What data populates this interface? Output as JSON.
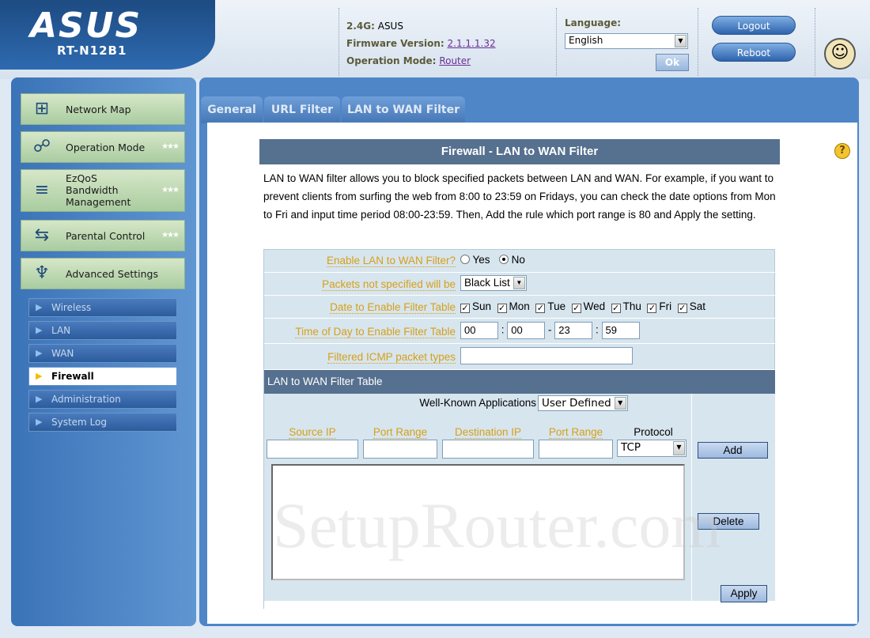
{
  "brand": {
    "logo": "ASUS",
    "model": "RT-N12B1"
  },
  "status": {
    "band_label": "2.4G:",
    "band_value": "ASUS",
    "firmware_label": "Firmware Version:",
    "firmware_value": "2.1.1.1.32",
    "mode_label": "Operation Mode:",
    "mode_value": "Router"
  },
  "language": {
    "label": "Language:",
    "selected": "English",
    "ok_label": "Ok"
  },
  "header_buttons": {
    "logout": "Logout",
    "reboot": "Reboot"
  },
  "sidebar": {
    "items": [
      {
        "label": "Network Map",
        "icon": "network-map-icon"
      },
      {
        "label": "Operation Mode",
        "icon": "operation-mode-icon"
      },
      {
        "label": "EzQoS\nBandwidth\nManagement",
        "icon": "ezqos-icon"
      },
      {
        "label": "Parental Control",
        "icon": "parental-control-icon"
      },
      {
        "label": "Advanced Settings",
        "icon": "advanced-settings-icon"
      }
    ],
    "sub_items": [
      "Wireless",
      "LAN",
      "WAN",
      "Firewall",
      "Administration",
      "System Log"
    ],
    "active_sub": "Firewall"
  },
  "tabs": [
    "General",
    "URL Filter",
    "LAN to WAN Filter"
  ],
  "page": {
    "title": "Firewall - LAN to WAN Filter",
    "description": "LAN to WAN filter allows you to block specified packets between LAN and WAN. For example, if you want to prevent clients from surfing the web from 8:00 to 23:59 on Fridays, you can check the date options from Mon to Fri and input time period 08:00-23:59. Then, Add the rule which port range is 80 and Apply the setting."
  },
  "form": {
    "enable_label": "Enable LAN to WAN Filter?",
    "enable_yes": "Yes",
    "enable_no": "No",
    "enable_value": "No",
    "packets_label": "Packets not specified will be",
    "packets_value": "Black List",
    "date_label": "Date to Enable Filter Table",
    "days": [
      {
        "label": "Sun",
        "checked": true
      },
      {
        "label": "Mon",
        "checked": true
      },
      {
        "label": "Tue",
        "checked": true
      },
      {
        "label": "Wed",
        "checked": true
      },
      {
        "label": "Thu",
        "checked": true
      },
      {
        "label": "Fri",
        "checked": true
      },
      {
        "label": "Sat",
        "checked": true
      }
    ],
    "time_label": "Time of Day to Enable Filter Table",
    "time_start_h": "00",
    "time_start_m": "00",
    "time_end_h": "23",
    "time_end_m": "59",
    "icmp_label": "Filtered ICMP packet types",
    "icmp_value": ""
  },
  "filter_table": {
    "title": "LAN to WAN Filter Table",
    "well_known_label": "Well-Known Applications",
    "well_known_value": "User Defined",
    "columns": [
      "Source IP",
      "Port Range",
      "Destination IP",
      "Port Range",
      "Protocol"
    ],
    "protocol_value": "TCP",
    "add_label": "Add",
    "delete_label": "Delete",
    "apply_label": "Apply"
  },
  "watermark": "SetupRouter.com"
}
